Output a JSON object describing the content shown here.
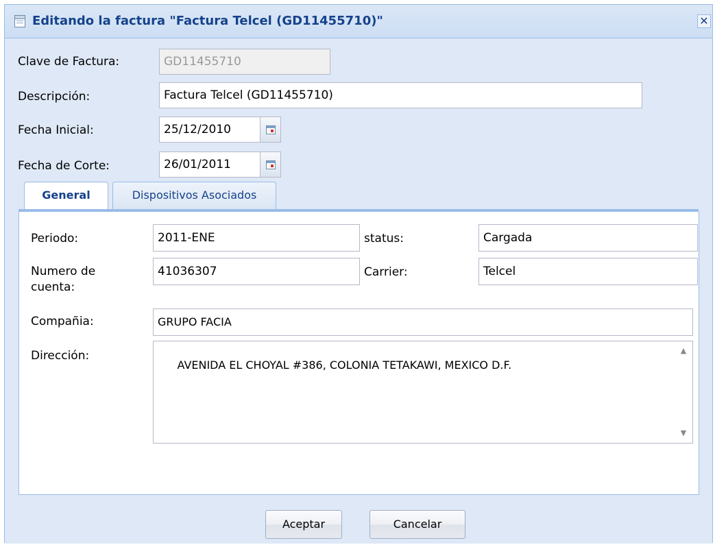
{
  "window": {
    "title": "Editando la factura \"Factura Telcel (GD11455710)\"",
    "close_glyph": "✕"
  },
  "fields": {
    "clave": {
      "label": "Clave de Factura:",
      "value": "GD11455710"
    },
    "descripcion": {
      "label": "Descripción:",
      "value": "Factura Telcel (GD11455710)"
    },
    "fecha_inicial": {
      "label": "Fecha Inicial:",
      "value": "25/12/2010"
    },
    "fecha_corte": {
      "label": "Fecha de Corte:",
      "value": "26/01/2011"
    }
  },
  "tabs": [
    {
      "label": "General",
      "active": true
    },
    {
      "label": "Dispositivos Asociados",
      "active": false
    }
  ],
  "general": {
    "periodo": {
      "label": "Periodo:",
      "value": "2011-ENE"
    },
    "status": {
      "label": "status:",
      "value": "Cargada"
    },
    "numero_cuenta": {
      "label_line1": "Numero de",
      "label_line2": "cuenta:",
      "value": "41036307"
    },
    "carrier": {
      "label": "Carrier:",
      "value": "Telcel"
    },
    "compania": {
      "label": "Compañia:",
      "value": "GRUPO FACIA"
    },
    "direccion": {
      "label": "Dirección:",
      "value": "AVENIDA EL CHOYAL #386, COLONIA TETAKAWI, MEXICO D.F."
    }
  },
  "buttons": {
    "accept": "Aceptar",
    "cancel": "Cancelar"
  },
  "icons": {
    "title": "invoice-icon",
    "calendar": "calendar-icon",
    "close": "close-icon"
  },
  "colors": {
    "title_text": "#15428b",
    "frame_border": "#99bbe8",
    "window_bg": "#dfe8f6"
  }
}
